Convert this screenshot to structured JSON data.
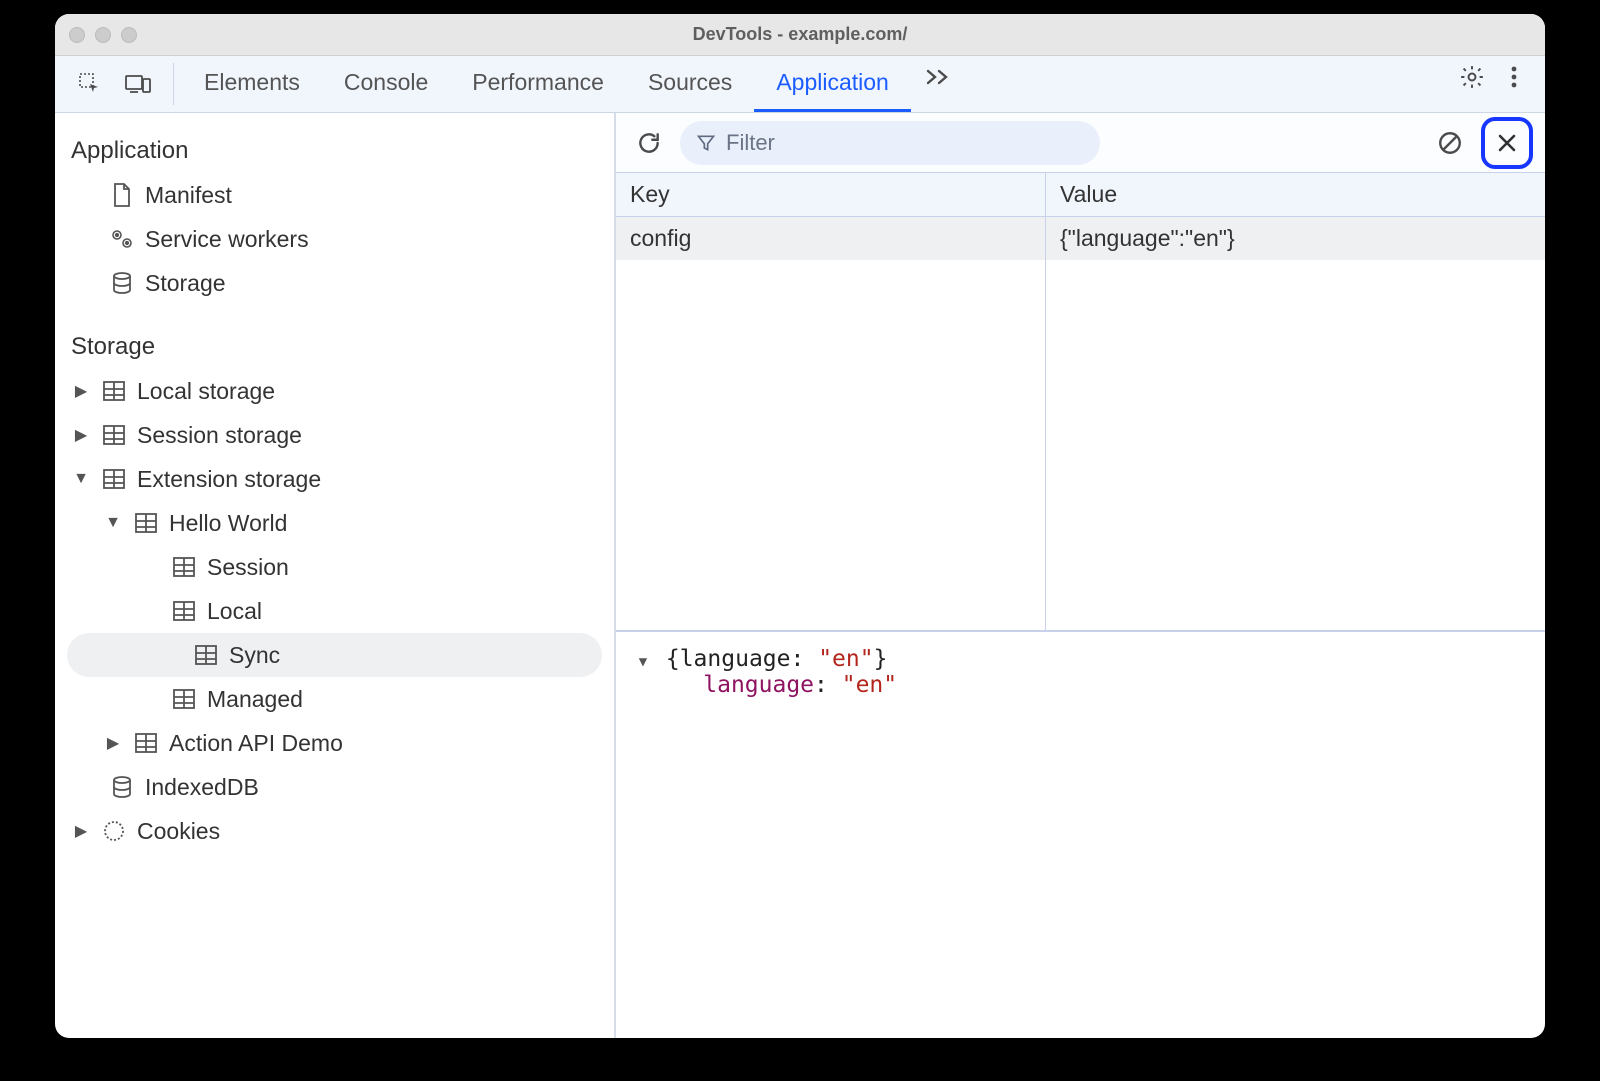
{
  "window": {
    "title": "DevTools - example.com/"
  },
  "tabs": {
    "items": [
      "Elements",
      "Console",
      "Performance",
      "Sources",
      "Application"
    ],
    "activeIndex": 4
  },
  "sidebar": {
    "groups": [
      {
        "title": "Application",
        "items": [
          {
            "icon": "file",
            "label": "Manifest"
          },
          {
            "icon": "gears",
            "label": "Service workers"
          },
          {
            "icon": "db",
            "label": "Storage"
          }
        ]
      },
      {
        "title": "Storage",
        "items": [
          {
            "icon": "table",
            "label": "Local storage",
            "expandable": true,
            "expanded": false
          },
          {
            "icon": "table",
            "label": "Session storage",
            "expandable": true,
            "expanded": false
          },
          {
            "icon": "table",
            "label": "Extension storage",
            "expandable": true,
            "expanded": true,
            "children": [
              {
                "icon": "table",
                "label": "Hello World",
                "expandable": true,
                "expanded": true,
                "children": [
                  {
                    "icon": "table",
                    "label": "Session"
                  },
                  {
                    "icon": "table",
                    "label": "Local"
                  },
                  {
                    "icon": "table",
                    "label": "Sync",
                    "selected": true
                  },
                  {
                    "icon": "table",
                    "label": "Managed"
                  }
                ]
              },
              {
                "icon": "table",
                "label": "Action API Demo",
                "expandable": true,
                "expanded": false
              }
            ]
          },
          {
            "icon": "db",
            "label": "IndexedDB"
          },
          {
            "icon": "cookie",
            "label": "Cookies",
            "expandable": true,
            "expanded": false
          }
        ]
      }
    ]
  },
  "toolbar": {
    "filter_placeholder": "Filter"
  },
  "table": {
    "headers": {
      "key": "Key",
      "value": "Value"
    },
    "rows": [
      {
        "key": "config",
        "value": "{\"language\":\"en\"}"
      }
    ]
  },
  "preview": {
    "summary_prefix": "{language: ",
    "summary_value": "\"en\"",
    "summary_suffix": "}",
    "prop_key": "language",
    "prop_value": "\"en\""
  }
}
